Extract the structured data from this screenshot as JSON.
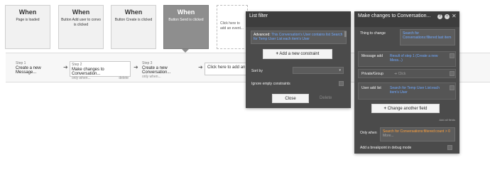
{
  "events": [
    {
      "when": "When",
      "desc": "Page is loaded"
    },
    {
      "when": "When",
      "desc": "Button Add user to convo is clicked"
    },
    {
      "when": "When",
      "desc": "Button Create is clicked"
    },
    {
      "when": "When",
      "desc": "Button Send is clicked"
    }
  ],
  "event_add": "Click here to add an event...",
  "steps": [
    {
      "num": "Step 1",
      "title": "Create a new Message..."
    },
    {
      "num": "Step 2",
      "title": "Make changes to Conversation...",
      "meta_left": "only when...",
      "meta_right": "delete"
    },
    {
      "num": "Step 3",
      "title": "Create a new Conversation...",
      "meta_left": "only when..."
    }
  ],
  "action_add": "Click here to add an action...",
  "list_filter": {
    "title": "List filter",
    "advanced_label": "Advanced:",
    "advanced_value": "This Conversation's User contains list Search for Temp User List:each item's User",
    "add_constraint": "Add a new constraint",
    "sort_by": "Sort by",
    "ignore_empty": "Ignore empty constraints",
    "close": "Close",
    "delete": "Delete"
  },
  "make_changes": {
    "title": "Make changes to Conversation...",
    "thing_label": "Thing to change",
    "thing_value": "Search for Conversations:filtered:last item",
    "message_label": "Message add",
    "message_value": "Result of step 1 (Create a new Mess...)",
    "private_label": "Private/Group",
    "private_value": "Click",
    "user_label": "User add list",
    "user_value": "Search for Temp User List:each item's User",
    "change_field": "Change another field",
    "add_all": "Add all fields",
    "only_when_label": "Only when",
    "only_when_value": "Search for Conversations:filtered:count > 0",
    "only_when_more": "More...",
    "breakpoint": "Add a breakpoint in debug mode"
  },
  "colors": {
    "link": "#6fa8ff",
    "orange": "#ffa13d",
    "selected_event": "#8e8e8e"
  }
}
